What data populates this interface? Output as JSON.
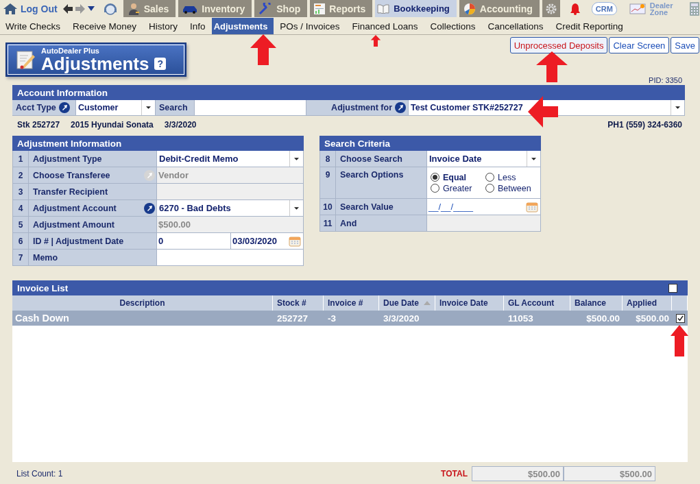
{
  "top_nav": {
    "logout": "Log Out",
    "tabs": [
      {
        "label": "Sales",
        "selected": false
      },
      {
        "label": "Inventory",
        "selected": false
      },
      {
        "label": "Shop",
        "selected": false
      },
      {
        "label": "Reports",
        "selected": false
      },
      {
        "label": "Bookkeeping",
        "selected": true
      },
      {
        "label": "Accounting",
        "selected": false
      }
    ],
    "crm": "CRM",
    "dealer_zone": "Dealer Zone"
  },
  "sub_menu": [
    {
      "label": "Write Checks",
      "selected": false
    },
    {
      "label": "Receive Money",
      "selected": false
    },
    {
      "label": "History",
      "selected": false
    },
    {
      "label": "Info",
      "selected": false
    },
    {
      "label": "Adjustments",
      "selected": true
    },
    {
      "label": "POs / Invoices",
      "selected": false
    },
    {
      "label": "Financed Loans",
      "selected": false
    },
    {
      "label": "Collections",
      "selected": false
    },
    {
      "label": "Cancellations",
      "selected": false
    },
    {
      "label": "Credit Reporting",
      "selected": false
    }
  ],
  "header": {
    "brand": "AutoDealer Plus",
    "title": "Adjustments",
    "help": "?"
  },
  "actions": [
    {
      "label": "Unprocessed Deposits",
      "kind": "alert"
    },
    {
      "label": "Clear Screen",
      "kind": "normal"
    },
    {
      "label": "Save",
      "kind": "normal"
    }
  ],
  "pid": "PID: 3350",
  "account": {
    "title": "Account Information",
    "acct_type_label": "Acct Type",
    "acct_type": "Customer",
    "search_label": "Search",
    "adjustment_for_label": "Adjustment for",
    "adjustment_for": "Test Customer  STK#252727"
  },
  "vehicle": {
    "stock": "Stk 252727",
    "vehicle": "2015 Hyundai Sonata",
    "date": "3/3/2020",
    "phone": "PH1 (559) 324-6360"
  },
  "adjustment_info": {
    "title": "Adjustment Information",
    "rows": [
      {
        "num": "1",
        "label": "Adjustment Type",
        "kind": "select",
        "value": "Debit-Credit Memo"
      },
      {
        "num": "2",
        "label": "Choose Transferee",
        "kind": "readonly",
        "value": "Vendor",
        "has_lookup": true,
        "disabled": true
      },
      {
        "num": "3",
        "label": "Transfer Recipient",
        "kind": "readonly"
      },
      {
        "num": "4",
        "label": "Adjustment Account",
        "kind": "select",
        "value": "6270 - Bad Debts",
        "has_lookup": true,
        "disabled": false
      },
      {
        "num": "5",
        "label": "Adjustment Amount",
        "kind": "readonly",
        "value": "$500.00"
      },
      {
        "num": "6",
        "label": "ID # | Adjustment Date",
        "kind": "id-date",
        "value": "0",
        "date": "03/03/2020"
      },
      {
        "num": "7",
        "label": "Memo",
        "kind": "text"
      }
    ]
  },
  "search_criteria": {
    "title": "Search Criteria",
    "rows": [
      {
        "num": "8",
        "label": "Choose Search",
        "kind": "select",
        "value": "Invoice Date"
      },
      {
        "num": "9",
        "label": "Search Options",
        "kind": "radios",
        "options": [
          {
            "label": "Equal",
            "selected": true
          },
          {
            "label": "Less",
            "selected": false
          },
          {
            "label": "Greater",
            "selected": false
          },
          {
            "label": "Between",
            "selected": false
          }
        ]
      },
      {
        "num": "10",
        "label": "Search Value",
        "kind": "date",
        "value": "__/__/____"
      },
      {
        "num": "11",
        "label": "And",
        "kind": "readonly"
      }
    ]
  },
  "invoice_list": {
    "title": "Invoice List",
    "all_checked": false,
    "columns": [
      {
        "label": "Description",
        "sorted": false
      },
      {
        "label": "Stock #",
        "sorted": false
      },
      {
        "label": "Invoice #",
        "sorted": false
      },
      {
        "label": "Due Date",
        "sorted": true
      },
      {
        "label": "Invoice Date",
        "sorted": false
      },
      {
        "label": "GL Account",
        "sorted": false
      },
      {
        "label": "Balance",
        "sorted": false
      },
      {
        "label": "Applied",
        "sorted": false
      }
    ],
    "rows": [
      {
        "cells": [
          "Cash Down",
          "252727",
          "-3",
          "3/3/2020",
          "",
          "11053",
          "$500.00",
          "$500.00"
        ],
        "selected": true,
        "checked": true
      }
    ]
  },
  "footer": {
    "list_count": "List Count:  1",
    "total_label": "TOTAL",
    "totals": [
      "$500.00",
      "$500.00"
    ]
  }
}
